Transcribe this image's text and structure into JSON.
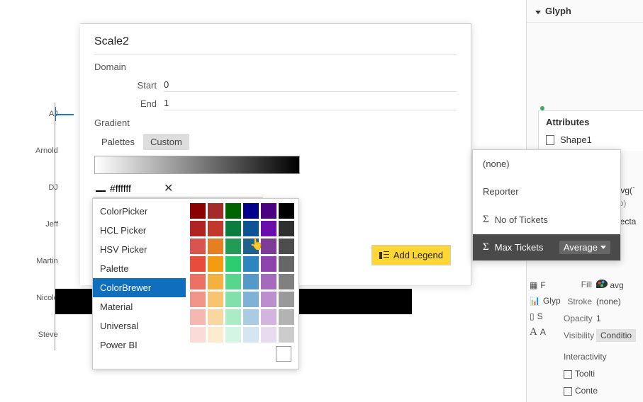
{
  "axis": [
    "AJ",
    "Arnold",
    "DJ",
    "Jeff",
    "Martin",
    "Nicole",
    "Steve"
  ],
  "scale": {
    "title": "Scale2",
    "domain_label": "Domain",
    "start_label": "Start",
    "start_value": "0",
    "end_label": "End",
    "end_value": "1",
    "gradient_label": "Gradient",
    "tab_palettes": "Palettes",
    "tab_custom": "Custom",
    "hex_value": "#ffffff",
    "add_legend": "Add Legend"
  },
  "picker": {
    "items": [
      "ColorPicker",
      "HCL Picker",
      "HSV Picker",
      "Palette",
      "ColorBrewer",
      "Material",
      "Universal",
      "Power BI"
    ],
    "selected_index": 4,
    "swatches": [
      [
        "#8b0000",
        "#a52a2a",
        "#006400",
        "#00008b",
        "#4b0082",
        "#000000"
      ],
      [
        "#b22222",
        "#c0392b",
        "#0b7d3e",
        "#0b5394",
        "#6a0dad",
        "#2f2f2f"
      ],
      [
        "#d9534f",
        "#e67e22",
        "#239b56",
        "#1f618d",
        "#7d3c98",
        "#4d4d4d"
      ],
      [
        "#e74c3c",
        "#f39c12",
        "#2ecc71",
        "#2e86c1",
        "#8e44ad",
        "#666666"
      ],
      [
        "#ec7063",
        "#f5b041",
        "#58d68d",
        "#5499c7",
        "#a569bd",
        "#808080"
      ],
      [
        "#f1948a",
        "#f8c471",
        "#82e0aa",
        "#7fb3d5",
        "#bb8fce",
        "#999999"
      ],
      [
        "#f5b7b1",
        "#fad7a0",
        "#abebc6",
        "#a9cce3",
        "#d2b4de",
        "#b3b3b3"
      ],
      [
        "#fadbd8",
        "#fdebd0",
        "#d5f5e3",
        "#d4e6f1",
        "#e8daef",
        "#cccccc"
      ]
    ]
  },
  "ctx": {
    "none": "(none)",
    "reporter": "Reporter",
    "no_tickets": "No of Tickets",
    "max_tickets": "Max Tickets",
    "average": "Average"
  },
  "glyph": {
    "title": "Glyph",
    "attributes": "Attributes",
    "shape": "Shape1",
    "avg_fx": "avg(`",
    "auto": "(auto)",
    "recta": "Recta",
    "fill_label": "Fill",
    "fill_value": "avg",
    "stroke_label": "Stroke",
    "stroke_value": "(none)",
    "opacity_label": "Opacity",
    "opacity_value": "1",
    "visibility_label": "Visibility",
    "visibility_value": "Conditio",
    "interactivity": "Interactivity",
    "tooltip": "Toolti",
    "context": "Conte",
    "right_icons": [
      "F",
      "Glyp",
      "S",
      "A"
    ]
  }
}
